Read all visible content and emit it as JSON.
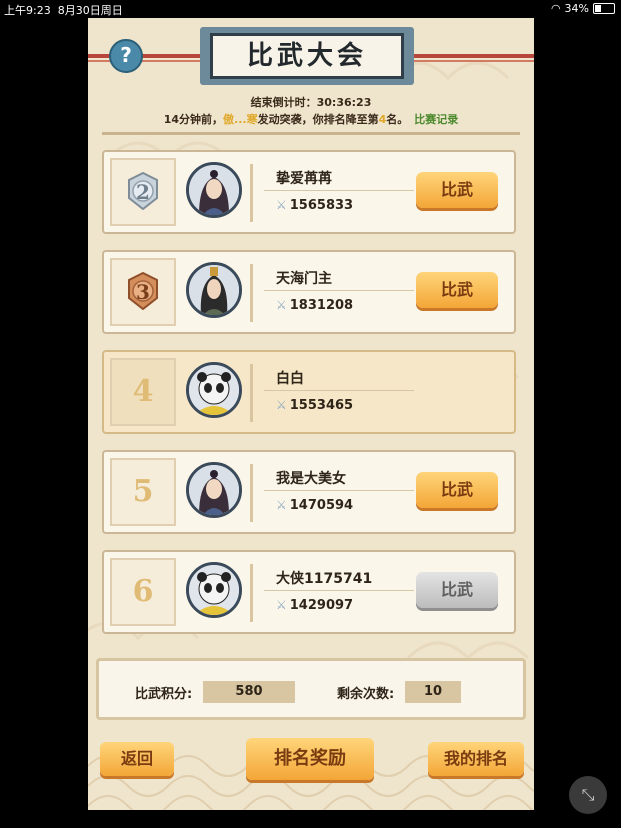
{
  "status_bar": {
    "time": "上午9:23",
    "date": "8月30日周日",
    "battery": "34%",
    "battery_level": 0.34
  },
  "title": "比武大会",
  "countdown": {
    "label": "结束倒计时：",
    "value": "30:36:23"
  },
  "notice": {
    "prefix": "14分钟前，",
    "attacker": "傲...寒",
    "middle": "发动突袭，你排名降至第",
    "rank": "4",
    "suffix": "名。",
    "link": "比赛记录"
  },
  "players": [
    {
      "rank": "2",
      "badge": "silver",
      "name": "挚爱苒苒",
      "power": "1565833",
      "button": "比武",
      "enabled": true,
      "avatar": "female-hero"
    },
    {
      "rank": "3",
      "badge": "bronze",
      "name": "天海门主",
      "power": "1831208",
      "button": "比武",
      "enabled": true,
      "avatar": "male-hero"
    },
    {
      "rank": "4",
      "badge": "",
      "name": "白白",
      "power": "1553465",
      "button": "",
      "enabled": false,
      "avatar": "panda",
      "is_self": true
    },
    {
      "rank": "5",
      "badge": "",
      "name": "我是大美女",
      "power": "1470594",
      "button": "比武",
      "enabled": true,
      "avatar": "female-hero"
    },
    {
      "rank": "6",
      "badge": "",
      "name": "大侠1175741",
      "power": "1429097",
      "button": "比武",
      "enabled": false,
      "avatar": "panda"
    }
  ],
  "score": {
    "points_label": "比武积分:",
    "points": "580",
    "remaining_label": "剩余次数:",
    "remaining": "10"
  },
  "buttons": {
    "back": "返回",
    "rewards": "排名奖励",
    "my_rank": "我的排名"
  },
  "colors": {
    "accent": "#f3a637",
    "panel": "#efe4cc",
    "title_frame": "#6d8a9a",
    "rope": "#b8463c"
  }
}
